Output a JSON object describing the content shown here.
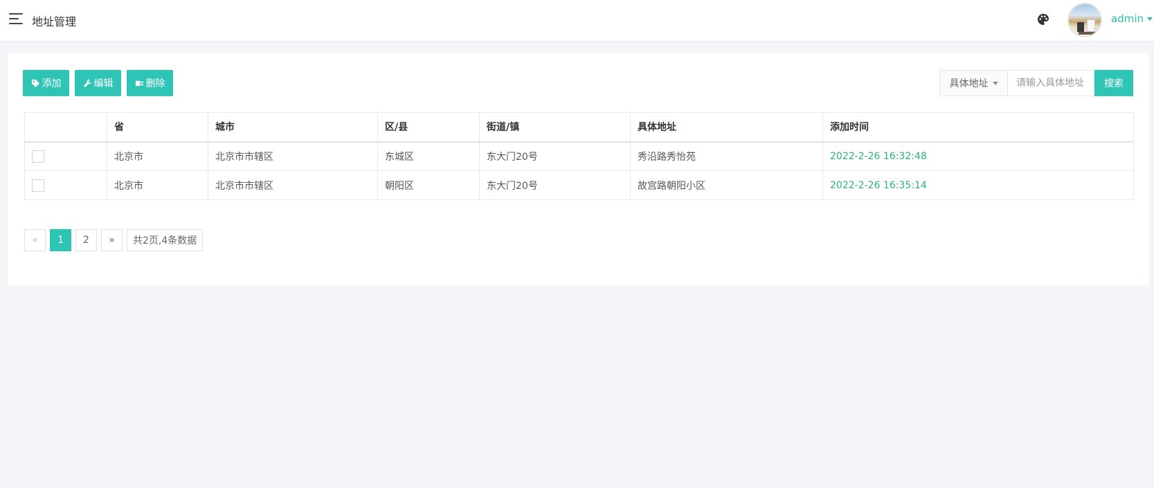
{
  "header": {
    "title": "地址管理",
    "user": "admin"
  },
  "toolbar": {
    "add_label": "添加",
    "edit_label": "编辑",
    "delete_label": "删除"
  },
  "search": {
    "field_label": "具体地址",
    "placeholder": "请输入具体地址",
    "button_label": "搜索"
  },
  "table": {
    "columns": [
      "省",
      "城市",
      "区/县",
      "街道/镇",
      "具体地址",
      "添加时间"
    ],
    "rows": [
      [
        "北京市",
        "北京市市辖区",
        "东城区",
        "东大门20号",
        "秀沿路秀怡苑",
        "2022-2-26 16:32:48"
      ],
      [
        "北京市",
        "北京市市辖区",
        "朝阳区",
        "东大门20号",
        "故宫路朝阳小区",
        "2022-2-26 16:35:14"
      ]
    ]
  },
  "pagination": {
    "prev": "«",
    "pages": [
      "1",
      "2"
    ],
    "current": "1",
    "next": "»",
    "summary": "共2页,4条数据"
  },
  "colors": {
    "accent": "#2ec4b6",
    "user": "#2bc0a8",
    "timestamp": "#2ab27b"
  }
}
